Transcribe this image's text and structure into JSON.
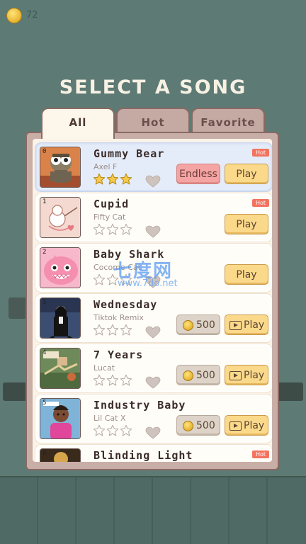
{
  "header": {
    "coins": "72",
    "title": "SELECT A SONG"
  },
  "tabs": [
    {
      "label": "All",
      "active": true
    },
    {
      "label": "Hot",
      "active": false
    },
    {
      "label": "Favorite",
      "active": false
    }
  ],
  "songs": [
    {
      "index": "0",
      "title": "Gummy Bear",
      "artist": "Axel F",
      "stars_filled": 3,
      "hot": true,
      "hot_label": "Hot",
      "secondary": "Endless",
      "play": "Play",
      "selected": true
    },
    {
      "index": "1",
      "title": "Cupid",
      "artist": "Fifty Cat",
      "stars_filled": 0,
      "hot": true,
      "hot_label": "Hot",
      "play": "Play"
    },
    {
      "index": "2",
      "title": "Baby Shark",
      "artist": "Cocome Cat",
      "stars_filled": 0,
      "hot": false,
      "play": "Play"
    },
    {
      "index": "3",
      "title": "Wednesday",
      "artist": "Tiktok Remix",
      "stars_filled": 0,
      "hot": false,
      "price": "500",
      "play": "Play"
    },
    {
      "index": "4",
      "title": "7 Years",
      "artist": "Lucat",
      "stars_filled": 0,
      "hot": false,
      "price": "500",
      "play": "Play"
    },
    {
      "index": "5",
      "title": "Industry Baby",
      "artist": "Lil Cat X",
      "stars_filled": 0,
      "hot": false,
      "price": "500",
      "play": "Play"
    },
    {
      "index": "6",
      "title": "Blinding Light",
      "hot": true,
      "hot_label": "Hot"
    }
  ],
  "watermark": {
    "text": "七度网",
    "url": "www.7do.net"
  },
  "colors": {
    "background": "#5d7a74",
    "title": "#f7f1e4",
    "play_button": "#fbd98b",
    "endless_button": "#f4a5a3",
    "hot_badge": "#f3735f",
    "selected_row": "#e5ecf9"
  }
}
